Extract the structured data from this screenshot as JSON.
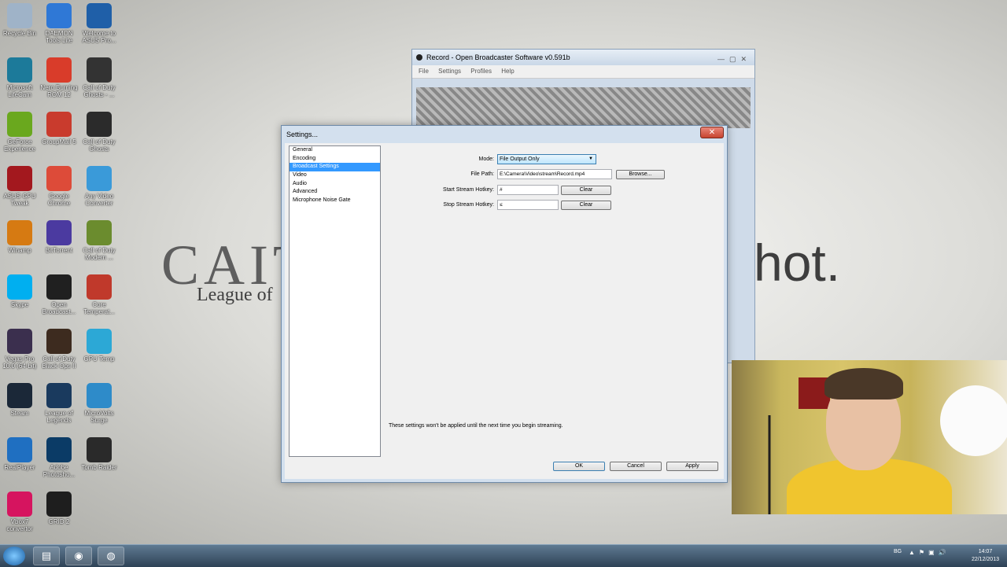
{
  "wallpaper": {
    "text_left": "CAIT",
    "text_left_sub": "League of",
    "text_right": "shot."
  },
  "desktop_icons": [
    {
      "label": "Recycle Bin",
      "icon": "recycle-bin-icon",
      "color": "#9fb3c8"
    },
    {
      "label": "DAEMON Tools Lite",
      "icon": "daemon-tools-icon",
      "color": "#2f78d6"
    },
    {
      "label": "Welcome to ASUS Pro...",
      "icon": "asus-icon",
      "color": "#1f5fa8"
    },
    {
      "label": "Microsoft LifeCam",
      "icon": "lifecam-icon",
      "color": "#1c7a9a"
    },
    {
      "label": "Nero Burning ROM 12",
      "icon": "nero-icon",
      "color": "#d93c2a"
    },
    {
      "label": "Call of Duty Ghosts - ...",
      "icon": "cod-ghosts-icon",
      "color": "#333333"
    },
    {
      "label": "GeForce Experience",
      "icon": "geforce-icon",
      "color": "#6aa81e"
    },
    {
      "label": "GroupMail 5",
      "icon": "groupmail-icon",
      "color": "#c93b2d"
    },
    {
      "label": "Call of Duty Ghosts",
      "icon": "cod-ghosts-icon",
      "color": "#2b2b2b"
    },
    {
      "label": "ASUS GPU Tweak",
      "icon": "gpu-tweak-icon",
      "color": "#a3181e"
    },
    {
      "label": "Google Chrome",
      "icon": "chrome-icon",
      "color": "#dd4b39"
    },
    {
      "label": "Any Video Converter",
      "icon": "video-converter-icon",
      "color": "#3a9ad9"
    },
    {
      "label": "Winamp",
      "icon": "winamp-icon",
      "color": "#d67a12"
    },
    {
      "label": "BitTorrent",
      "icon": "bittorrent-icon",
      "color": "#4b3aa0"
    },
    {
      "label": "Call of Duty Modern ...",
      "icon": "cod-mw3-icon",
      "color": "#6b8c2e"
    },
    {
      "label": "Skype",
      "icon": "skype-icon",
      "color": "#00aff0"
    },
    {
      "label": "Open Broadcast...",
      "icon": "obs-icon",
      "color": "#202020"
    },
    {
      "label": "Core Temperat...",
      "icon": "core-temp-icon",
      "color": "#c0392b"
    },
    {
      "label": "Vegas Pro 10.0 (64-bit)",
      "icon": "vegas-icon",
      "color": "#3b2f4e"
    },
    {
      "label": "Call of Duty Black Ops II",
      "icon": "cod-bo2-icon",
      "color": "#3d2b1f"
    },
    {
      "label": "GPU Temp",
      "icon": "gpu-temp-icon",
      "color": "#2ca8d6"
    },
    {
      "label": "Steam",
      "icon": "steam-icon",
      "color": "#1b2838"
    },
    {
      "label": "League of Legends",
      "icon": "lol-icon",
      "color": "#1a3a5e"
    },
    {
      "label": "MicroVolts Surge",
      "icon": "microvolts-icon",
      "color": "#2e8bc9"
    },
    {
      "label": "RealPlayer",
      "icon": "realplayer-icon",
      "color": "#1f6fc1"
    },
    {
      "label": "Adobe Photosho...",
      "icon": "photoshop-icon",
      "color": "#0b3b66"
    },
    {
      "label": "Tomb Raider",
      "icon": "tomb-raider-icon",
      "color": "#2a2a2a"
    },
    {
      "label": "Vbox7 convertor",
      "icon": "vbox7-icon",
      "color": "#d6145f"
    },
    {
      "label": "GRID 2",
      "icon": "grid2-icon",
      "color": "#1e1e1e"
    }
  ],
  "obs_window": {
    "title": "Record - Open Broadcaster Software v0.591b",
    "menu": [
      "File",
      "Settings",
      "Profiles",
      "Help"
    ]
  },
  "settings": {
    "title": "Settings...",
    "close_label": "✕",
    "nav": [
      "General",
      "Encoding",
      "Broadcast Settings",
      "Video",
      "Audio",
      "Advanced",
      "Microphone Noise Gate"
    ],
    "selected_nav": "Broadcast Settings",
    "mode_label": "Mode:",
    "mode_value": "File Output Only",
    "file_path_label": "File Path:",
    "file_path_value": "E:\\Camera\\Video\\stream\\Record.mp4",
    "browse_label": "Browse...",
    "start_hotkey_label": "Start Stream Hotkey:",
    "start_hotkey_value": "#",
    "stop_hotkey_label": "Stop Stream Hotkey:",
    "stop_hotkey_value": "≤",
    "clear_label": "Clear",
    "note": "These settings won't be applied until the next time you begin streaming.",
    "ok_label": "OK",
    "cancel_label": "Cancel",
    "apply_label": "Apply"
  },
  "taskbar": {
    "apps": [
      {
        "icon": "explorer-icon",
        "glyph": "▤"
      },
      {
        "icon": "chrome-icon",
        "glyph": "◉"
      },
      {
        "icon": "obs-icon",
        "glyph": "◍"
      }
    ],
    "language": "BG",
    "time": "14:07",
    "date": "22/12/2013"
  }
}
